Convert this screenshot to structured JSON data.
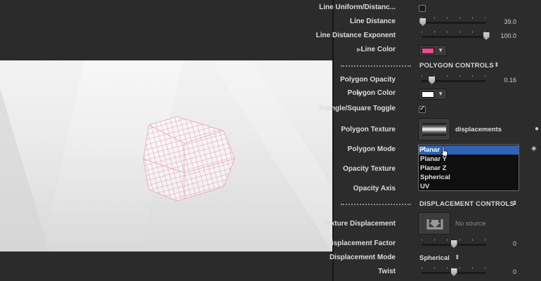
{
  "inspector": {
    "line_uniform_label": "Line Uniform/Distanc...",
    "line_distance": {
      "label": "Line Distance",
      "value": "39.0",
      "level": 0.02
    },
    "line_distance_exponent": {
      "label": "Line Distance Exponent",
      "value": "100.0",
      "level": 1.0
    },
    "line_color": {
      "label": "Line Color",
      "color": "#f0488c"
    },
    "polygon_controls_title": "POLYGON CONTROLS",
    "polygon_opacity": {
      "label": "Polygon Opacity",
      "value": "0.16",
      "level": 0.16
    },
    "polygon_color": {
      "label": "Polygon Color",
      "color": "#ffffff"
    },
    "triangle_toggle": {
      "label": "Triangle/Square Toggle",
      "checked": true
    },
    "polygon_texture": {
      "label": "Polygon Texture",
      "name": "displacements"
    },
    "polygon_mode_label": "Polygon Mode",
    "opacity_texture_label": "Opacity Texture",
    "opacity_axis_label": "Opacity Axis",
    "displacement_controls_title": "DISPLACEMENT CONTROLS",
    "texture_displacement": {
      "label": "Texture Displacement",
      "source": "No source"
    },
    "displacement_factor": {
      "label": "Displacement Factor",
      "value": "0",
      "level": 0.5
    },
    "displacement_mode": {
      "label": "Displacement Mode",
      "value": "Spherical"
    },
    "twist": {
      "label": "Twist",
      "value": "0",
      "level": 0.5
    }
  },
  "dropdown": {
    "options": [
      "Planar",
      "Planar Y",
      "Planar Z",
      "Spherical",
      "UV"
    ],
    "selected": "Planar"
  },
  "colors": {
    "selection": "#2e63b8",
    "panel": "#2c2c2c",
    "mesh": "#e8a0b8"
  },
  "icons": [
    "disclosure-triangle-icon",
    "checkmark-icon",
    "popup-arrows-icon",
    "pointer-cursor-icon",
    "keyframe-diamond-icon"
  ]
}
